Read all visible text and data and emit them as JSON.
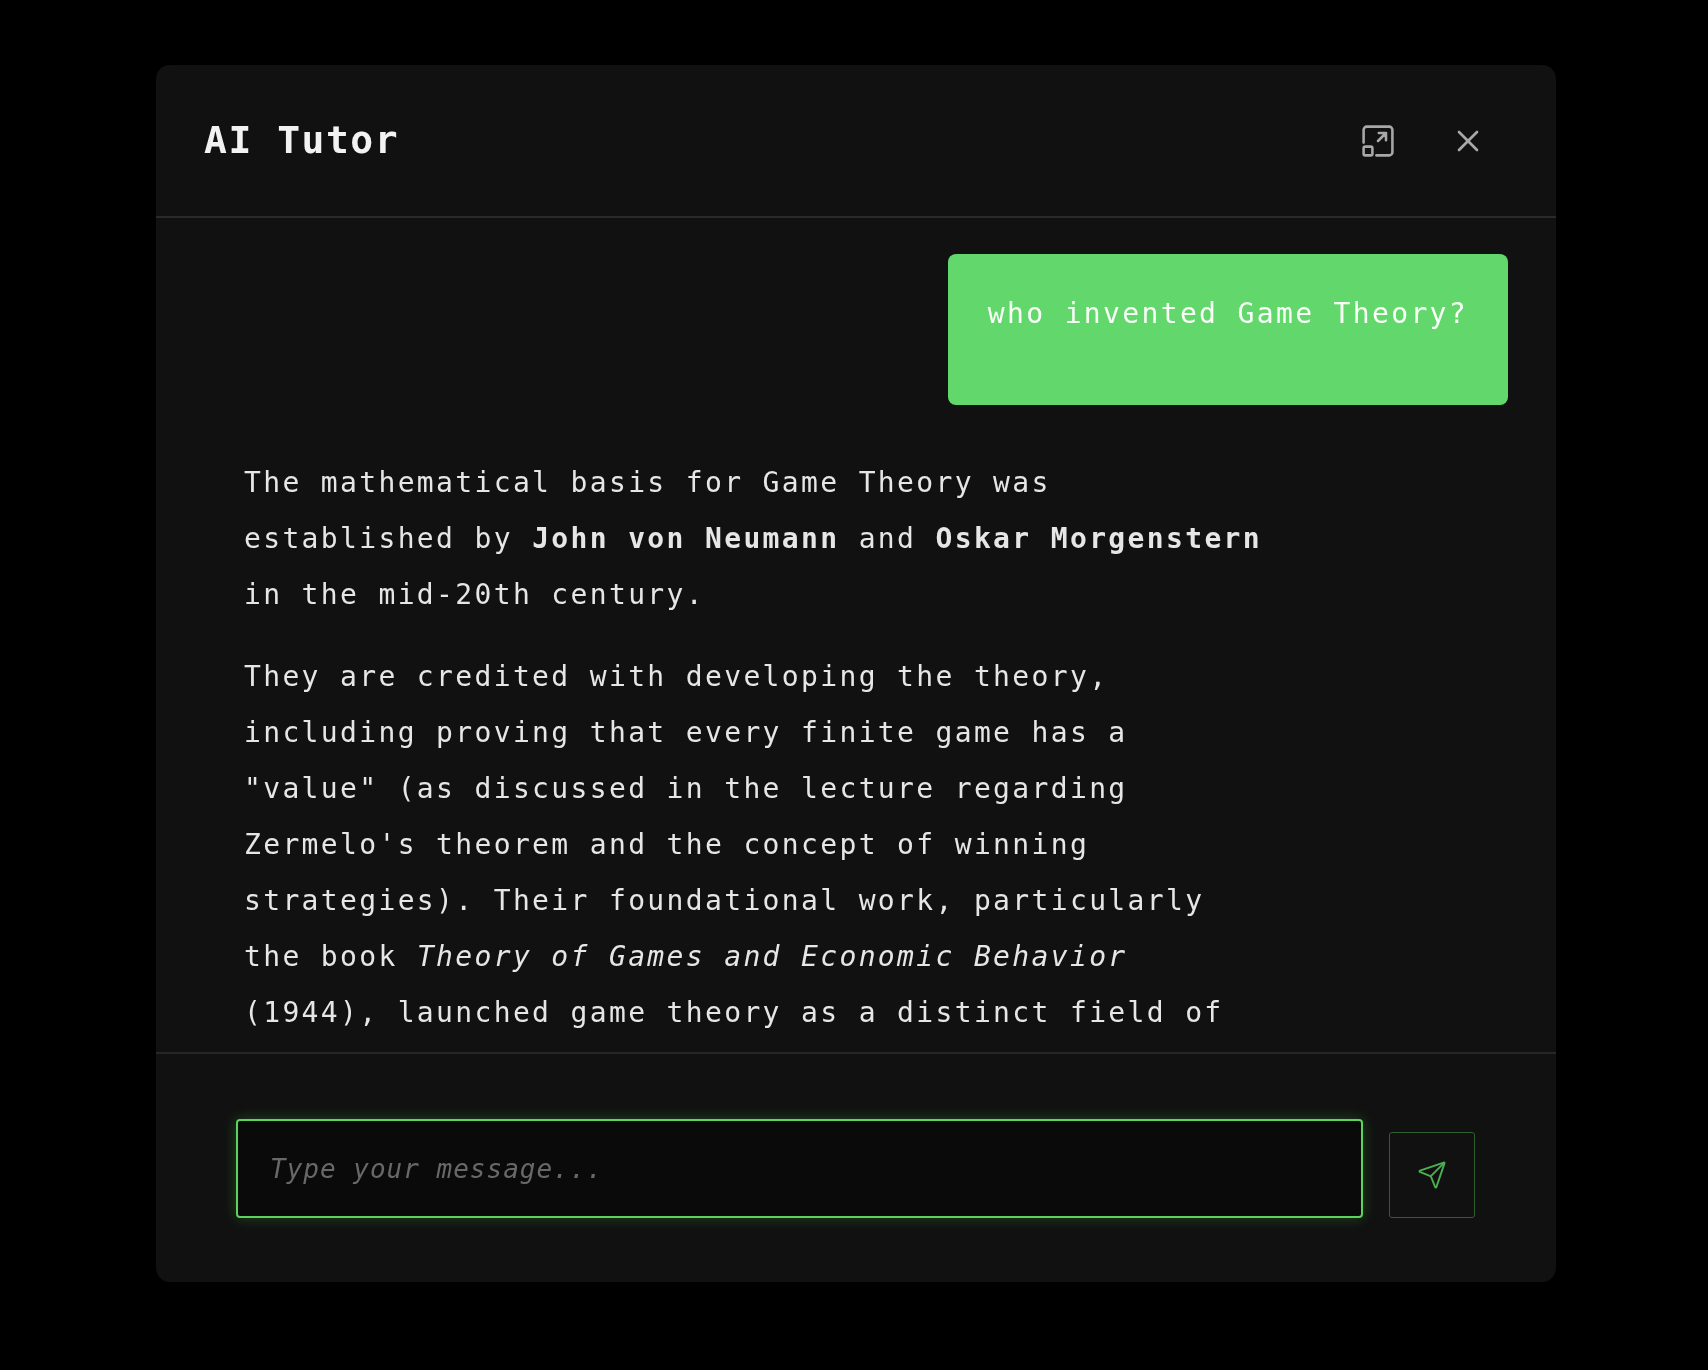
{
  "dialog": {
    "title": "AI Tutor"
  },
  "messages": [
    {
      "kind": "user",
      "paragraphs": [
        "who invented Game Theory?"
      ]
    },
    {
      "kind": "assistant",
      "paragraphs": [
        "The mathematical basis for Game Theory was established by **John von Neumann** and **Oskar Morgenstern** in the mid-20th century.",
        "They are credited with developing the theory, including proving that every finite game has a \"value\" (as discussed in the lecture regarding Zermelo's theorem and the concept of winning strategies). Their foundational work, particularly the book *Theory of Games and Economic Behavior* (1944), launched game theory as a distinct field of"
      ]
    }
  ],
  "composer": {
    "placeholder": "Type your message...",
    "focused": true
  }
}
